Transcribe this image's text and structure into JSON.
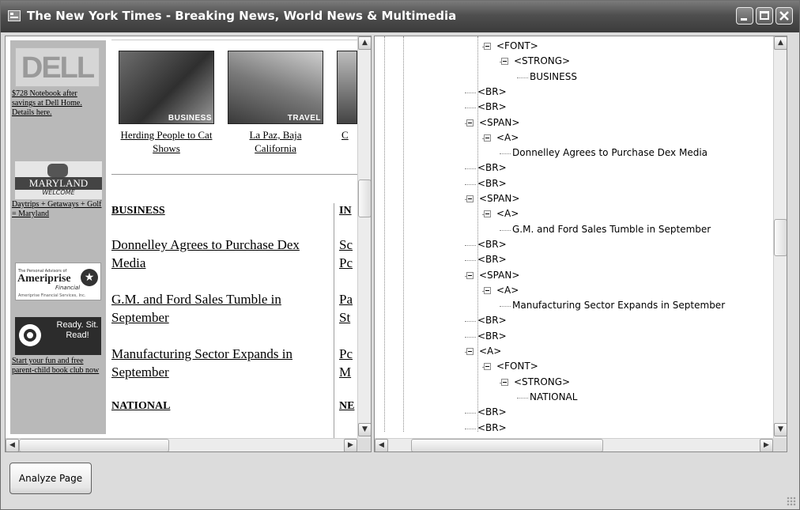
{
  "window": {
    "title": "The New York Times - Breaking News, World News & Multimedia"
  },
  "ads": {
    "dell_logo": "DELL",
    "dell_text": "$728 Notebook after savings at Dell Home. Details here.",
    "maryland_logo": "MARYLAND",
    "maryland_welcome": "WELCOME",
    "maryland_text": "Daytrips + Getaways + Golf = Maryland",
    "ameriprise_small": "The Personal Advisors of",
    "ameriprise_logo": "Ameriprise",
    "ameriprise_financial": "Financial",
    "ameriprise_services": "Ameriprise Financial Services, Inc.",
    "target_copy": "Ready. Sit. Read!",
    "target_text": "Start your fun and free parent-child book club now"
  },
  "photos": [
    {
      "tag": "BUSINESS",
      "caption": "Herding People to Cat Shows"
    },
    {
      "tag": "TRAVEL",
      "caption": "La Paz, Baja California"
    },
    {
      "tag": "",
      "caption": "C"
    }
  ],
  "sections": {
    "business": "BUSINESS",
    "national": "NATIONAL",
    "right_col_head_1": "IN",
    "right_col_head_2": "NE"
  },
  "headlines": [
    "Donnelley Agrees to Purchase Dex Media",
    "G.M. and Ford Sales Tumble in September",
    "Manufacturing Sector Expands in September"
  ],
  "right_col_links": [
    "Sc Pc",
    "Pa St",
    "Pc M"
  ],
  "tree": [
    {
      "label": "<FONT>",
      "expander": true
    },
    {
      "label": "<STRONG>",
      "expander": true
    },
    {
      "label": "BUSINESS",
      "expander": false
    },
    {
      "label": "<BR>",
      "expander": false
    },
    {
      "label": "<BR>",
      "expander": false
    },
    {
      "label": "<SPAN>",
      "expander": true
    },
    {
      "label": "<A>",
      "expander": true
    },
    {
      "label": "Donnelley Agrees to Purchase Dex Media",
      "expander": false
    },
    {
      "label": "<BR>",
      "expander": false
    },
    {
      "label": "<BR>",
      "expander": false
    },
    {
      "label": "<SPAN>",
      "expander": true
    },
    {
      "label": "<A>",
      "expander": true
    },
    {
      "label": "G.M. and Ford Sales Tumble in September",
      "expander": false
    },
    {
      "label": "<BR>",
      "expander": false
    },
    {
      "label": "<BR>",
      "expander": false
    },
    {
      "label": "<SPAN>",
      "expander": true
    },
    {
      "label": "<A>",
      "expander": true
    },
    {
      "label": "Manufacturing Sector Expands in September",
      "expander": false
    },
    {
      "label": "<BR>",
      "expander": false
    },
    {
      "label": "<BR>",
      "expander": false
    },
    {
      "label": "<A>",
      "expander": true
    },
    {
      "label": "<FONT>",
      "expander": true
    },
    {
      "label": "<STRONG>",
      "expander": true
    },
    {
      "label": "NATIONAL",
      "expander": false
    },
    {
      "label": "<BR>",
      "expander": false
    },
    {
      "label": "<BR>",
      "expander": false
    }
  ],
  "buttons": {
    "analyze": "Analyze Page"
  },
  "icons": {
    "app": "window-icon",
    "minimize": "minimize-icon",
    "maximize": "maximize-icon",
    "close": "close-icon",
    "scroll_up": "arrow-up-icon",
    "scroll_down": "arrow-down-icon",
    "scroll_left": "arrow-left-icon",
    "scroll_right": "arrow-right-icon"
  }
}
